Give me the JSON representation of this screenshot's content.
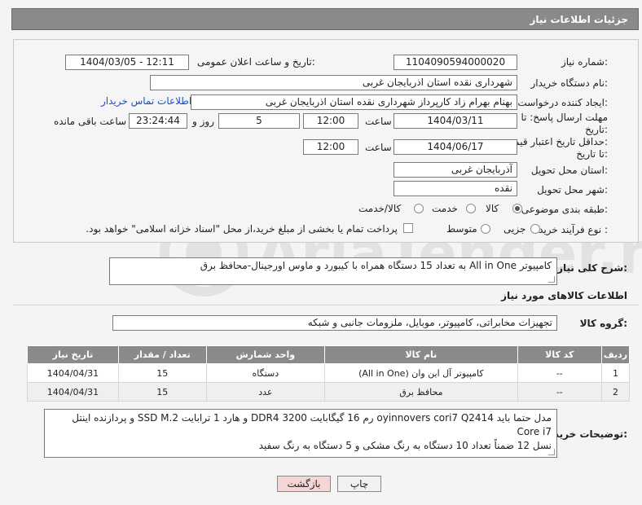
{
  "header": {
    "title": "جزئیات اطلاعات نیاز"
  },
  "form": {
    "need_number_label": "شماره نیاز:",
    "need_number": "1104090594000020",
    "announce_label": "تاریخ و ساعت اعلان عمومی:",
    "announce_value": "1404/03/05 - 12:11",
    "buyer_org_label": "نام دستگاه خریدار:",
    "buyer_org": "شهرداری نقده استان اذربایجان غربی",
    "creator_label": "ایجاد کننده درخواست:",
    "creator": "بهنام بهرام زاد کارپرداز شهرداری نقده استان اذربایجان غربی",
    "contact_link": "اطلاعات تماس خریدار",
    "deadline_label_1": "مهلت ارسال پاسخ: تا",
    "deadline_label_2": "تاریخ:",
    "deadline_date": "1404/03/11",
    "time_label": "ساعت",
    "deadline_time": "12:00",
    "day_label": "روز و",
    "days": "5",
    "remaining": "23:24:44",
    "remaining_label": "ساعت باقی مانده",
    "validity_label_1": "حداقل تاریخ اعتبار قیمت:",
    "validity_label_2": "تا تاریخ:",
    "validity_date": "1404/06/17",
    "validity_time_label": "ساعت",
    "validity_time": "12:00",
    "province_label": "استان محل تحویل:",
    "province": "آذربایجان غربی",
    "city_label": "شهر محل تحویل:",
    "city": "نقده",
    "category_label": "طبقه بندی موضوعی:",
    "category_options": [
      "کالا",
      "خدمت",
      "کالا/خدمت"
    ],
    "category_selected": "کالا",
    "process_label": "نوع فرآیند خرید :",
    "process_options": [
      "جزیی",
      "متوسط"
    ],
    "payment_note": "پرداخت تمام یا بخشی از مبلغ خرید،از محل \"اسناد خزانه اسلامی\" خواهد بود."
  },
  "summary": {
    "label": "شرح کلی نیاز:",
    "text": "کامپیوتر All in One به تعداد 15 دستگاه  همراه با کیبورد و ماوس اورجینال-محافظ برق"
  },
  "goods": {
    "section_title": "اطلاعات کالاهای مورد نیاز",
    "group_label": "گروه کالا:",
    "group_value": "تجهیزات مخابراتی، کامپیوتر، موبایل، ملزومات جانبی و شبکه",
    "columns": [
      "ردیف",
      "کد کالا",
      "نام کالا",
      "واحد شمارش",
      "تعداد / مقدار",
      "تاریخ نیاز"
    ],
    "rows": [
      [
        "1",
        "--",
        "کامپیوتر آل این وان (All in One)",
        "دستگاه",
        "15",
        "1404/04/31"
      ],
      [
        "2",
        "--",
        "محافظ برق",
        "عدد",
        "15",
        "1404/04/31"
      ]
    ]
  },
  "buyer_notes": {
    "label": "توضیحات خریدار:",
    "line1": "مدل حتما باید  oyinnovers cori7 Q2414  رم 16 گیگابایت DDR4 3200 و هارد  1 ترابایت SSD M.2 و پردازنده اینتل Core i7",
    "line2": "نسل 12 ضمناً تعداد 10 دستگاه به رنگ مشکی و 5 دستگاه به رنگ سفید"
  },
  "buttons": {
    "print": "چاپ",
    "back": "بازگشت"
  },
  "colors": {
    "header_bg": "#8a8a8a",
    "link": "#1a4fbf",
    "back_button": "#f5d6d6"
  }
}
